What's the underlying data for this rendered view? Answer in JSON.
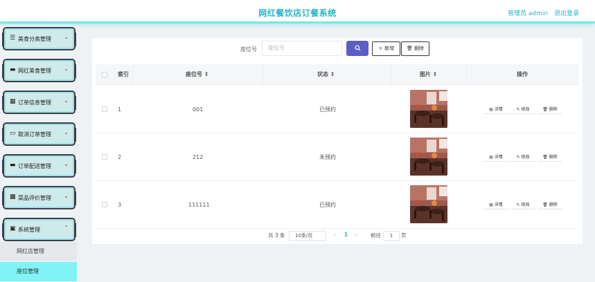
{
  "header": {
    "title": "网红餐饮店订餐系统",
    "admin": "管理员 admin",
    "logout": "退出登录"
  },
  "sidebar": {
    "items": [
      {
        "label": "美食分类管理",
        "icon": "list-icon"
      },
      {
        "label": "网红美食管理",
        "icon": "monitor-icon"
      },
      {
        "label": "订单信息管理",
        "icon": "grid-icon"
      },
      {
        "label": "取消订单管理",
        "icon": "chat-icon"
      },
      {
        "label": "订单配送管理",
        "icon": "monitor-icon"
      },
      {
        "label": "菜品评价管理",
        "icon": "film-icon"
      },
      {
        "label": "系统管理",
        "icon": "clipboard-icon"
      }
    ],
    "sub_items": [
      {
        "label": "网红店管理",
        "active": false
      },
      {
        "label": "座位管理",
        "active": true
      }
    ]
  },
  "search": {
    "label": "座位号",
    "placeholder": "座位号",
    "add_label": "＋ 新增",
    "delete_label": "🗑 删除"
  },
  "table": {
    "columns": [
      "索引",
      "座位号 ⇕",
      "状态 ⇕",
      "图片 ⇕",
      "操作"
    ],
    "rows": [
      {
        "index": "1",
        "seat": "001",
        "status": "已预约"
      },
      {
        "index": "2",
        "seat": "212",
        "status": "未预约"
      },
      {
        "index": "3",
        "seat": "111111",
        "status": "已预约"
      }
    ],
    "actions": [
      "▤ 详情",
      "✎ 修改",
      "🗑 删除"
    ]
  },
  "pagination": {
    "total": "共 3 条",
    "page_size": "10条/页",
    "prev": "‹",
    "current": "1",
    "next": "›",
    "goto_label": "前往",
    "goto_value": "1",
    "page_unit": "页"
  },
  "colors": {
    "accent": "#2ab4c8",
    "search_button": "#5a5fc4",
    "active_menu": "#7ff3f5"
  }
}
